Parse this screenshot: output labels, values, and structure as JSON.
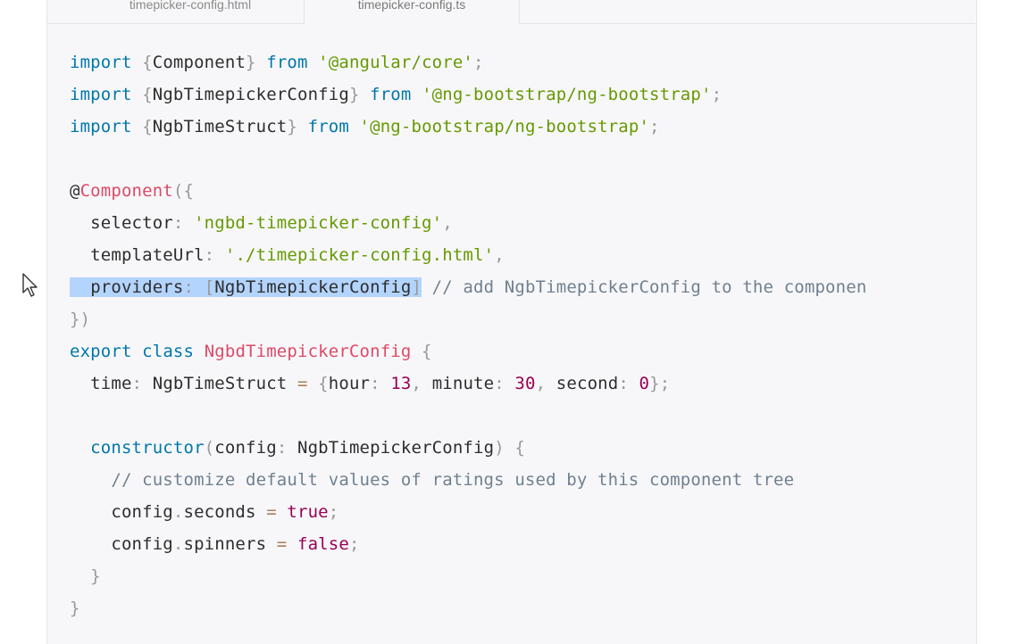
{
  "tabs": [
    {
      "label": "timepicker-config.html"
    },
    {
      "label": "timepicker-config.ts"
    }
  ],
  "code": {
    "line1": {
      "kw": "import",
      "a": " {",
      "b": "Component",
      "c": "} ",
      "kw2": "from",
      "s": " '@angular/core'",
      "e": ";"
    },
    "line2": {
      "kw": "import",
      "a": " {",
      "b": "NgbTimepickerConfig",
      "c": "} ",
      "kw2": "from",
      "s": " '@ng-bootstrap/ng-bootstrap'",
      "e": ";"
    },
    "line3": {
      "kw": "import",
      "a": " {",
      "b": "NgbTimeStruct",
      "c": "} ",
      "kw2": "from",
      "s": " '@ng-bootstrap/ng-bootstrap'",
      "e": ";"
    },
    "line5": {
      "at": "@",
      "dec": "Component",
      "p": "({"
    },
    "line6": {
      "prop": "  selector",
      "c": ": ",
      "s": "'ngbd-timepicker-config'",
      "e": ","
    },
    "line7": {
      "prop": "  templateUrl",
      "c": ": ",
      "s": "'./timepicker-config.html'",
      "e": ","
    },
    "line8": {
      "lead": "  ",
      "prop": "providers",
      "c": ": ",
      "o": "[",
      "v": "NgbTimepickerConfig",
      "cl": "]",
      "cmt": " // add NgbTimepickerConfig to the componen"
    },
    "line9": {
      "p": "})"
    },
    "line10": {
      "kw": "export",
      "sp": " ",
      "kw2": "class",
      "sp2": " ",
      "cls": "NgbdTimepickerConfig",
      "p": " {"
    },
    "line11": {
      "prop": "  time",
      "c": ": ",
      "t": "NgbTimeStruct ",
      "eq": "=",
      "o": " {",
      "k1": "hour",
      "c1": ": ",
      "n1": "13",
      "s1": ", ",
      "k2": "minute",
      "c2": ": ",
      "n2": "30",
      "s2": ", ",
      "k3": "second",
      "c3": ": ",
      "n3": "0",
      "e": "};"
    },
    "line13": {
      "fn": "  constructor",
      "o": "(",
      "arg": "config",
      "c": ": ",
      "t": "NgbTimepickerConfig",
      "p": ") {"
    },
    "line14": {
      "cmt": "    // customize default values of ratings used by this component tree"
    },
    "line15": {
      "obj": "    config",
      "d": ".",
      "prop": "seconds ",
      "eq": "=",
      "sp": " ",
      "v": "true",
      "e": ";"
    },
    "line16": {
      "obj": "    config",
      "d": ".",
      "prop": "spinners ",
      "eq": "=",
      "sp": " ",
      "v": "false",
      "e": ";"
    },
    "line17": {
      "p": "  }"
    },
    "line18": {
      "p": "}"
    }
  }
}
